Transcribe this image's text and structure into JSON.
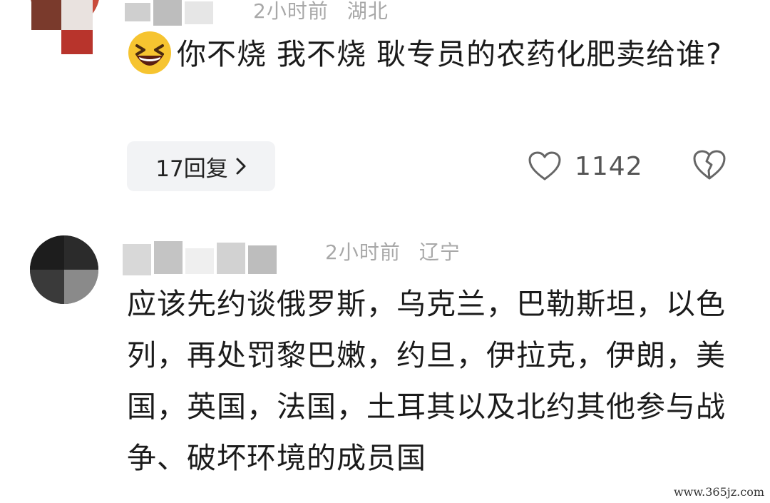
{
  "comments": [
    {
      "time": "2小时前",
      "location": "湖北",
      "emoji": "grinning-squinting-face",
      "text": "你不烧 我不烧 耿专员的农药化肥卖给谁?",
      "reply_label": "17回复",
      "like_count": "1142"
    },
    {
      "time": "2小时前",
      "location": "辽宁",
      "text": "应该先约谈俄罗斯，乌克兰，巴勒斯坦，以色列，再处罚黎巴嫩，约旦，伊拉克，伊朗，美国，英国，法国，土耳其以及北约其他参与战争、破坏环境的成员国"
    }
  ],
  "watermark": "www.365jz.com",
  "colors": {
    "text": "#1b1b1b",
    "meta": "#a8a8a8",
    "reply_bg": "#f2f3f5",
    "icon": "#666666"
  }
}
